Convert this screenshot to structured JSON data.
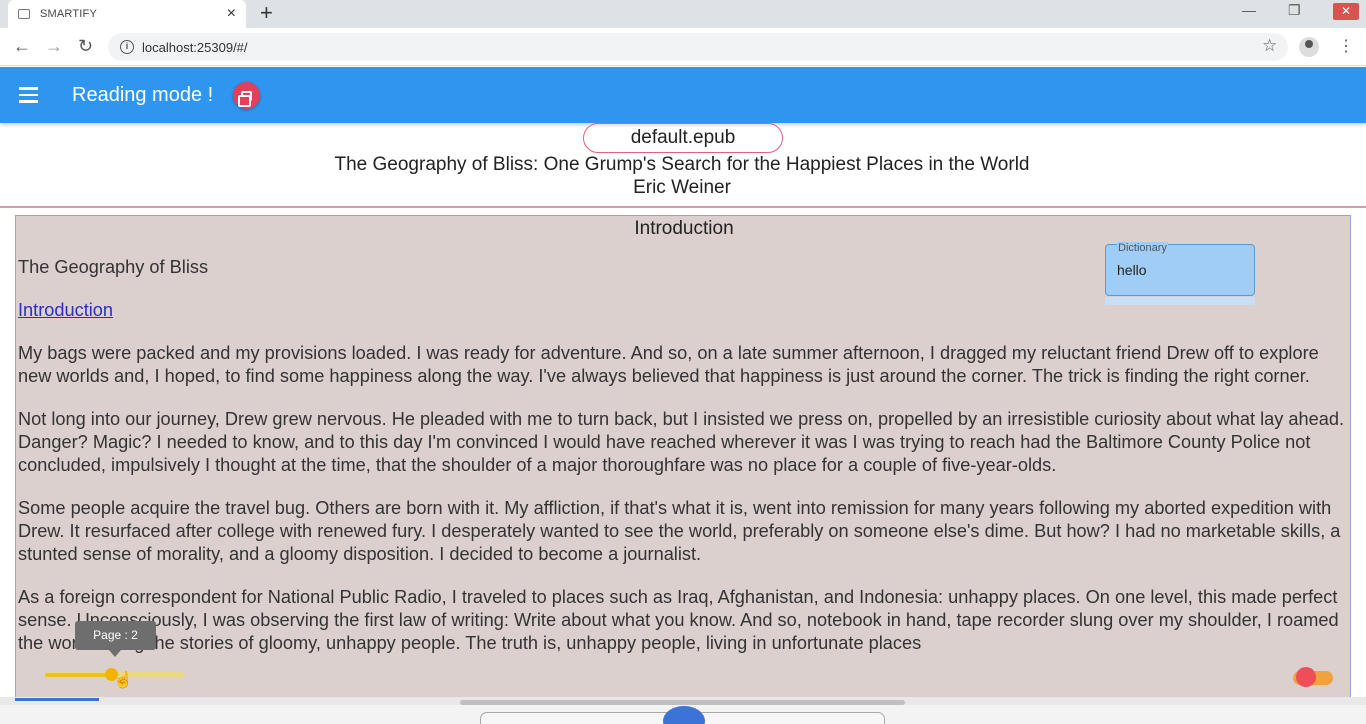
{
  "browser": {
    "tab_title": "SMARTIFY",
    "tab_close": "×",
    "new_tab": "+",
    "url": "localhost:25309/#/",
    "back": "←",
    "forward": "→",
    "reload": "↻",
    "star": "☆",
    "menu": "⋮",
    "minimize": "—",
    "restore": "❐",
    "close": "✕"
  },
  "appbar": {
    "title": "Reading mode !",
    "accent": "#2f96ef",
    "fab_color": "#e33e5a"
  },
  "book": {
    "file": "default.epub",
    "title": "The Geography of Bliss: One Grump's Search for the Happiest Places in the World",
    "author": "Eric Weiner"
  },
  "reader": {
    "chapter_heading": "Introduction",
    "book_name": "The Geography of Bliss",
    "toc_link": "Introduction",
    "paragraphs": [
      "My bags were packed and my provisions loaded. I was ready for adventure. And so, on a late summer afternoon, I dragged my reluctant friend Drew off to explore new worlds and, I hoped, to find some happiness along the way. I've always believed that happiness is just around the corner. The trick is finding the right corner.",
      "Not long into our journey, Drew grew nervous. He pleaded with me to turn back, but I insisted we press on, propelled by an irresistible curiosity about what lay ahead. Danger? Magic? I needed to know, and to this day I'm convinced I would have reached wherever it was I was trying to reach had the Baltimore County Police not concluded, impulsively I thought at the time, that the shoulder of a major thoroughfare was no place for a couple of five-year-olds.",
      "Some people acquire the travel bug. Others are born with it. My affliction, if that's what it is, went into remission for many years following my aborted expedition with Drew. It resurfaced after college with renewed fury. I desperately wanted to see the world, preferably on someone else's dime. But how? I had no marketable skills, a stunted sense of morality, and a gloomy disposition. I decided to become a journalist.",
      "As a foreign correspondent for National Public Radio, I traveled to places such as Iraq, Afghanistan, and Indonesia: unhappy places. On one level, this made perfect sense. Unconsciously, I was observing the first law of writing: Write about what you know. And so, notebook in hand, tape recorder slung over my shoulder, I roamed the world telling the stories of gloomy, unhappy people. The truth is, unhappy people, living in unfortunate places"
    ]
  },
  "dictionary": {
    "label": "Dictionary",
    "value": "hello"
  },
  "page_slider": {
    "tooltip": "Page : 2",
    "cursor": "☝"
  }
}
